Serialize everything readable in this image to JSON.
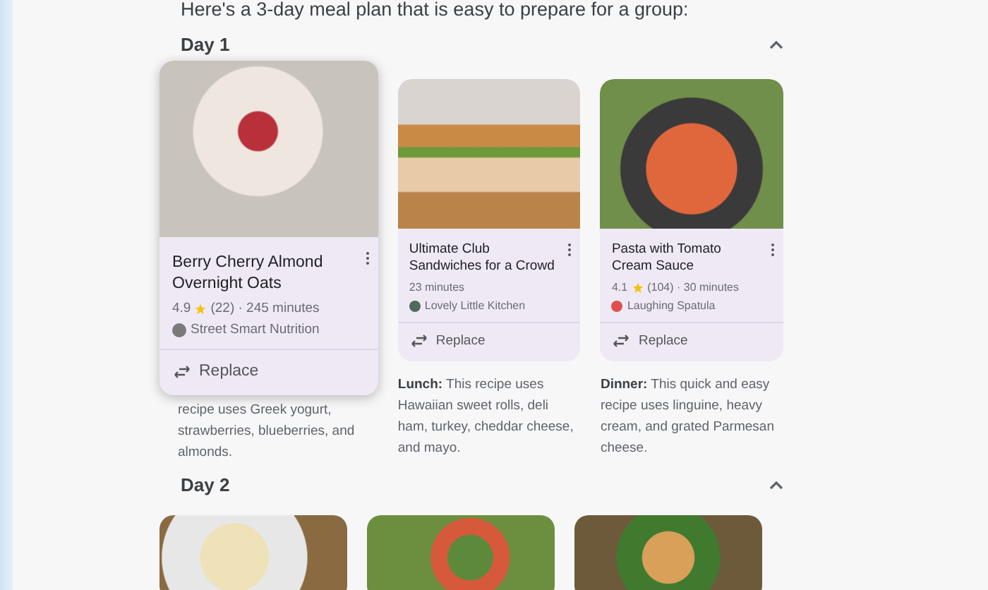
{
  "intro": "Here's a 3-day meal plan that is easy to prepare for a group:",
  "days": [
    {
      "title": "Day 1",
      "expanded": true,
      "meals": [
        {
          "raised": true,
          "title": "Berry Cherry Almond Overnight Oats",
          "rating": "4.9",
          "details": "(22) · 245 minutes",
          "source": "Street Smart Nutrition",
          "color": "#7a7a7a",
          "action": "Replace",
          "description": "recipe uses Greek yogurt, strawberries, blueberries, and almonds."
        },
        {
          "raised": false,
          "title": "Ultimate Club Sandwiches for a Crowd",
          "details": "23 minutes",
          "source": "Lovely Little Kitchen",
          "color": "#4f6a5c",
          "action": "Replace",
          "description": "**Lunch:** This recipe uses Hawaiian sweet rolls, deli ham, turkey, cheddar cheese, and mayo."
        },
        {
          "raised": false,
          "title": "Pasta with Tomato Cream Sauce",
          "rating": "4.1",
          "details": "(104) · 30 minutes",
          "source": "Laughing Spatula",
          "color": "#e0504f",
          "action": "Replace",
          "description": "**Dinner:** This quick and easy recipe uses linguine, heavy cream, and grated Parmesan cheese."
        }
      ]
    },
    {
      "title": "Day 2",
      "expanded": true,
      "meals": [
        {
          "kind": "photo"
        },
        {
          "kind": "photo"
        },
        {
          "kind": "photo"
        }
      ]
    }
  ]
}
